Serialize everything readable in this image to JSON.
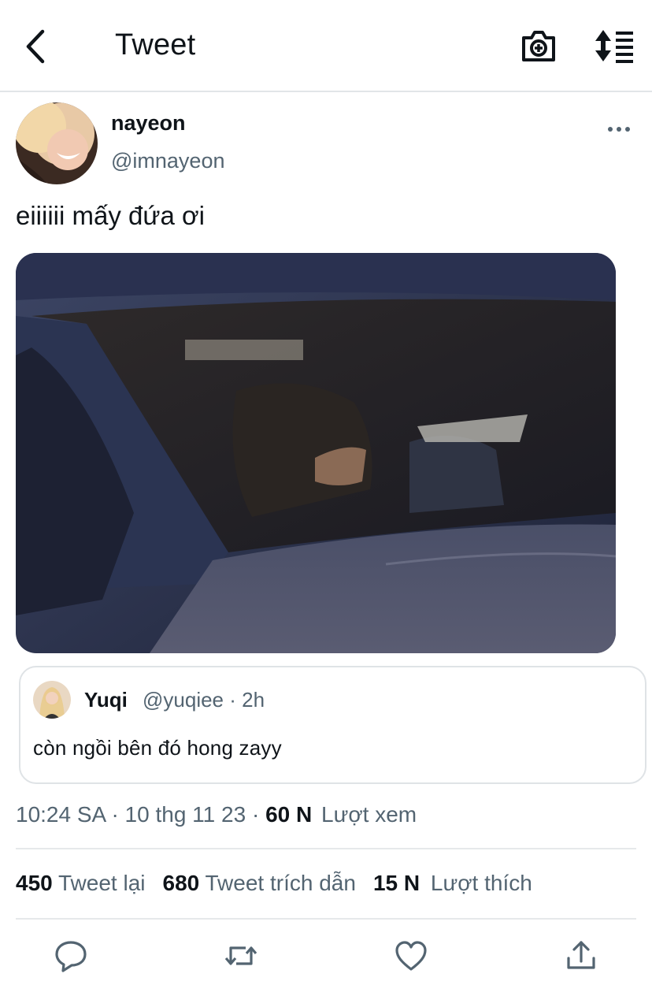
{
  "header": {
    "title": "Tweet"
  },
  "tweet": {
    "author_name": "nayeon",
    "author_handle": "@imnayeon",
    "text": "eiiiiii mấy đứa ơi"
  },
  "quote": {
    "name": "Yuqi",
    "meta": "@yuqiee · 2h",
    "text": "còn ngồi bên đó hong zayy"
  },
  "meta": {
    "time": "10:24 SA",
    "sep": "·",
    "date": "10 thg 11 23",
    "views_count": "60 N",
    "views_label": "Lượt xem"
  },
  "stats": [
    {
      "count": "450",
      "label": "Tweet lại"
    },
    {
      "count": "680",
      "label": "Tweet trích dẫn"
    },
    {
      "count": "15 N",
      "label": "Lượt thích"
    }
  ],
  "actions": [
    "reply-icon",
    "retweet-icon",
    "like-icon",
    "share-icon"
  ],
  "colors": {
    "text": "#0f1419",
    "secondary": "#536471",
    "icon": "#536471",
    "divider": "#e6e9eb"
  }
}
